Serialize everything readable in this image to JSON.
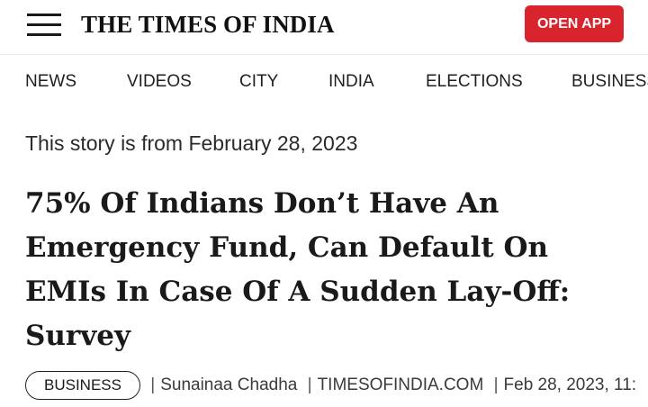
{
  "header": {
    "menu_icon": "hamburger-menu-icon",
    "brand": "THE TIMES OF INDIA",
    "open_app_label": "OPEN APP",
    "accent_color": "#d9232d"
  },
  "nav": {
    "items": [
      {
        "label": "NEWS"
      },
      {
        "label": "VIDEOS"
      },
      {
        "label": "CITY"
      },
      {
        "label": "INDIA"
      },
      {
        "label": "ELECTIONS"
      },
      {
        "label": "BUSINESS"
      }
    ]
  },
  "article": {
    "story_date": "This story is from February 28, 2023",
    "headline": "75% Of Indians Don’t Have An Emergency Fund, Can Default On EMIs In Case Of A Sudden Lay-Off: Survey",
    "section_tag": "BUSINESS",
    "author": "Sunainaa Chadha",
    "source": "TIMESOFINDIA.COM",
    "published": "Feb 28, 2023, 11:",
    "separator": "|"
  }
}
